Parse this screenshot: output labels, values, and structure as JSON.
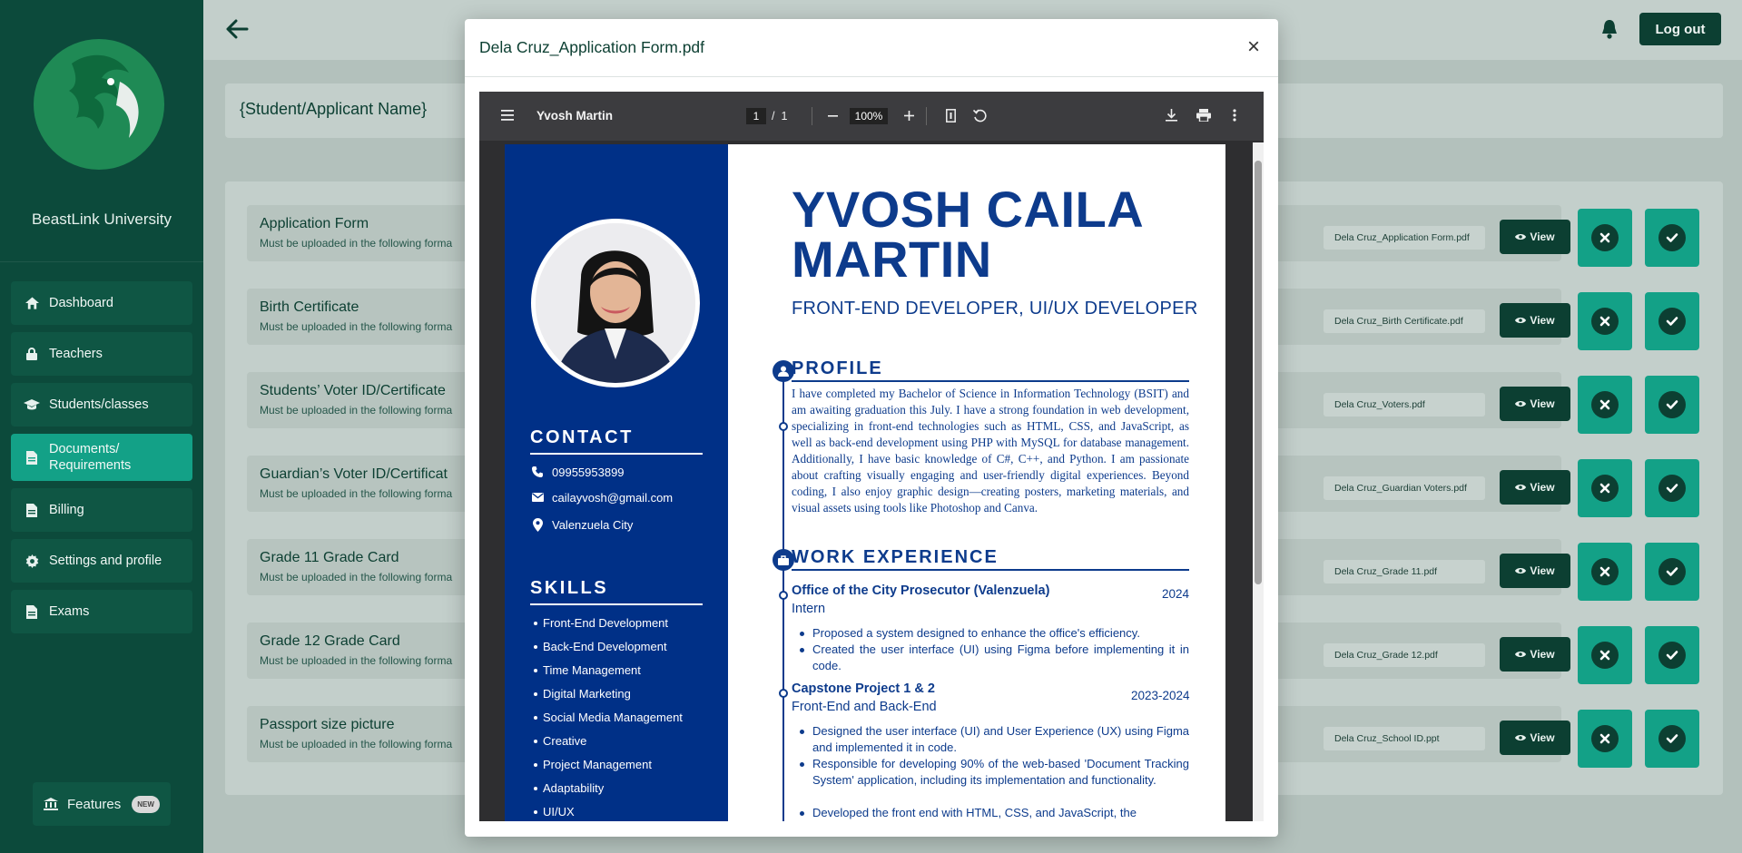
{
  "sidebar": {
    "university": "BeastLink University",
    "items": [
      {
        "label": "Dashboard",
        "icon": "home-icon"
      },
      {
        "label": "Teachers",
        "icon": "lock-icon"
      },
      {
        "label": "Students/classes",
        "icon": "graduation-cap-icon"
      },
      {
        "label": "Documents/ Requirements",
        "icon": "document-icon",
        "active": true
      },
      {
        "label": "Billing",
        "icon": "document-icon"
      },
      {
        "label": "Settings and profile",
        "icon": "gear-icon"
      },
      {
        "label": "Exams",
        "icon": "document-icon"
      }
    ],
    "features_label": "Features",
    "features_badge": "NEW"
  },
  "topbar": {
    "logout_label": "Log out"
  },
  "student_name": "{Student/Applicant Name}",
  "documents": {
    "subtitle": "Must be uploaded in the following forma",
    "view_label": "View",
    "rows": [
      {
        "title": "Application Form",
        "file": "Dela Cruz_Application Form.pdf"
      },
      {
        "title": "Birth Certificate",
        "file": "Dela Cruz_Birth Certificate.pdf"
      },
      {
        "title": "Students’ Voter ID/Certificate",
        "file": "Dela Cruz_Voters.pdf"
      },
      {
        "title": "Guardian’s Voter ID/Certificat",
        "file": "Dela Cruz_Guardian Voters.pdf"
      },
      {
        "title": "Grade 11 Grade Card",
        "file": "Dela Cruz_Grade 11.pdf"
      },
      {
        "title": "Grade 12 Grade Card",
        "file": "Dela Cruz_Grade 12.pdf"
      },
      {
        "title": "Passport size picture",
        "file": "Dela Cruz_School ID.ppt"
      }
    ]
  },
  "modal": {
    "title": "Dela Cruz_Application Form.pdf",
    "close_glyph": "×",
    "viewer": {
      "doc_name": "Yvosh Martin",
      "page_current": "1",
      "page_separator": "/",
      "page_total": "1",
      "zoom": "100%"
    },
    "resume": {
      "name_line1": "YVOSH CAILA",
      "name_line2": "MARTIN",
      "role": "FRONT-END DEVELOPER, UI/UX DEVELOPER",
      "contact_heading": "CONTACT",
      "phone": "09955953899",
      "email": "cailayvosh@gmail.com",
      "location": "Valenzuela City",
      "skills_heading": "SKILLS",
      "skills": [
        "Front-End Development",
        "Back-End Development",
        "Time Management",
        "Digital Marketing",
        "Social Media Management",
        "Creative",
        "Project Management",
        "Adaptability",
        "UI/UX"
      ],
      "profile_heading": "PROFILE",
      "profile_text": "I have completed my Bachelor of Science in Information Technology (BSIT) and am awaiting graduation this July. I have a strong foundation in web development, specializing in front-end technologies such as HTML, CSS, and JavaScript, as well as back-end development using PHP with MySQL for database management. Additionally, I have basic knowledge of C#, C++, and Python. I am passionate about crafting visually engaging and user-friendly digital experiences. Beyond coding, I also enjoy graphic design—creating posters, marketing materials, and visual assets using tools like Photoshop and Canva.",
      "work_heading": "WORK EXPERIENCE",
      "jobs": [
        {
          "title": "Office of the City Prosecutor (Valenzuela)",
          "year": "2024",
          "role": "Intern",
          "bullets": [
            "Proposed a system designed to enhance the office's efficiency.",
            "Created the user interface (UI) using Figma before implementing it in code."
          ]
        },
        {
          "title": "Capstone Project 1 & 2",
          "year": "2023-2024",
          "role": "Front-End and Back-End",
          "bullets": [
            "Designed the user interface (UI) and User Experience (UX) using Figma and implemented it in code.",
            "Responsible for developing 90% of the web-based 'Document Tracking System' application, including its implementation and functionality.",
            "Developed the front end with HTML, CSS, and JavaScript, the"
          ]
        }
      ]
    }
  },
  "colors": {
    "sidebar_bg": "#0c4a3b",
    "accent": "#13a187",
    "dark_button": "#0c3f32",
    "resume_blue": "#0d3b8c",
    "resume_sidebar": "#003087"
  }
}
